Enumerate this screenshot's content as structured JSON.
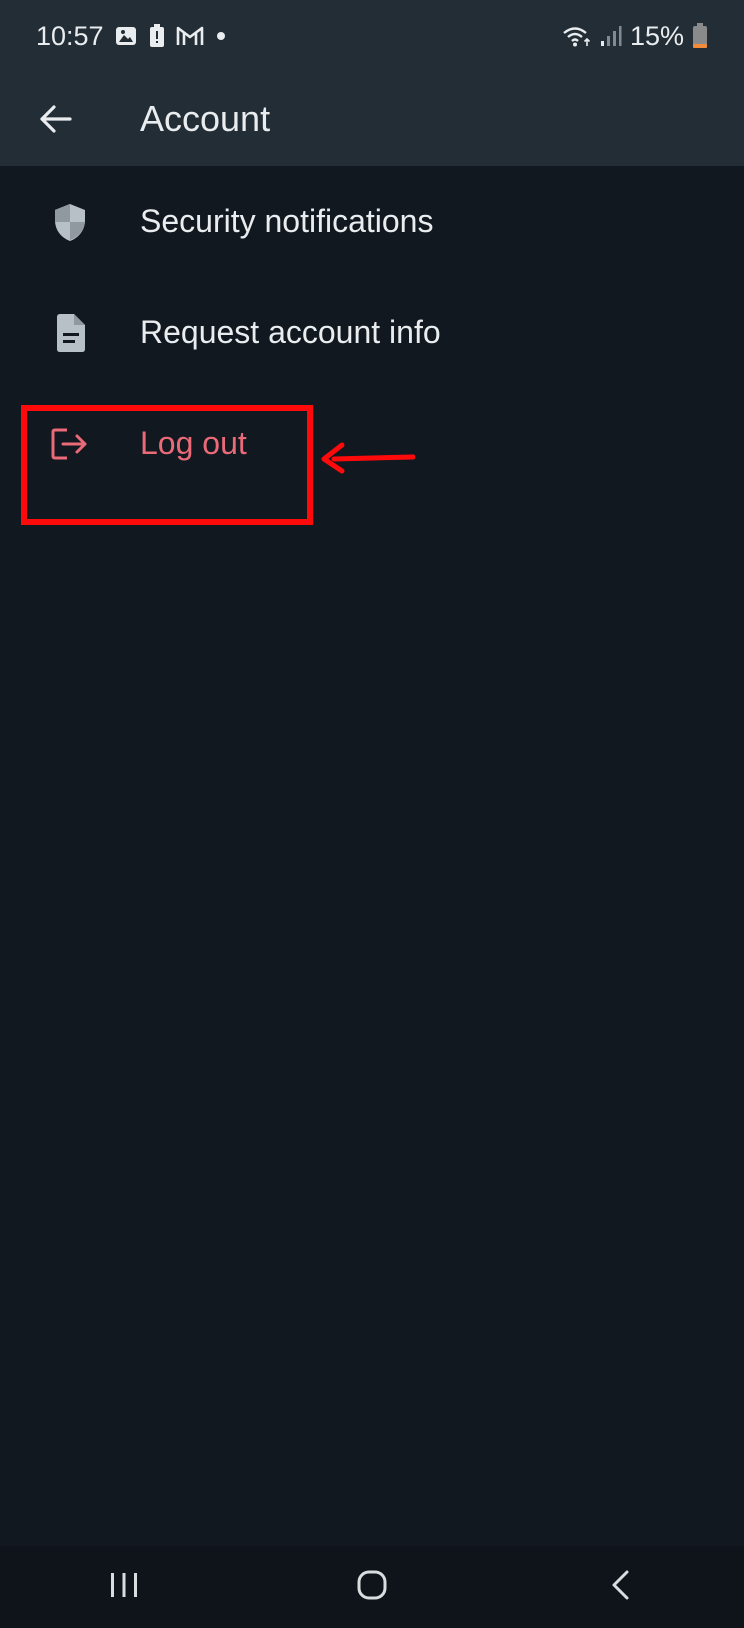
{
  "status_bar": {
    "time": "10:57",
    "battery_percent": "15%",
    "icons": [
      "gallery-icon",
      "battery-saver-icon",
      "gmail-icon",
      "notification-dot-icon",
      "wifi-icon",
      "signal-icon",
      "battery-icon"
    ]
  },
  "app_bar": {
    "title": "Account",
    "back_icon": "arrow-back-icon"
  },
  "menu": {
    "items": [
      {
        "label": "Security notifications",
        "icon": "shield-icon"
      },
      {
        "label": "Request account info",
        "icon": "document-icon"
      },
      {
        "label": "Log out",
        "icon": "logout-icon"
      }
    ]
  },
  "nav_bar": {
    "buttons": [
      "recents-icon",
      "home-icon",
      "back-icon"
    ]
  },
  "colors": {
    "background": "#121820",
    "bar": "#232d36",
    "text": "#e9edef",
    "danger": "#ea6a78",
    "annotation": "#ff0a0a"
  }
}
